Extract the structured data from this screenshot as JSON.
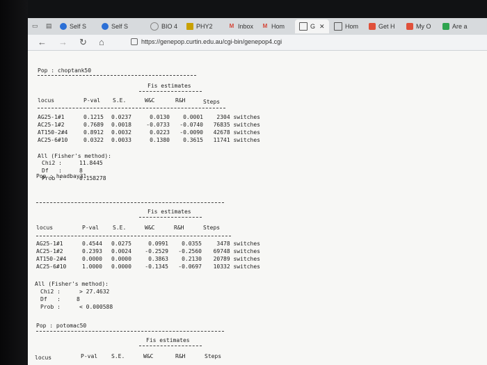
{
  "browser": {
    "tabs": [
      {
        "label": "Self S",
        "color": "#2b6fd6"
      },
      {
        "label": "Self S",
        "color": "#2b6fd6"
      },
      {
        "label": "BIO 4",
        "color": "#888"
      },
      {
        "label": "PHY2",
        "color": "#c8a000"
      },
      {
        "label": "Inbox",
        "color": "#d44638"
      },
      {
        "label": "Hom",
        "color": "#d44638"
      },
      {
        "label": "G",
        "color": "#666"
      },
      {
        "label": "Hom",
        "color": "#666"
      },
      {
        "label": "Get H",
        "color": "#e0503a"
      },
      {
        "label": "My O",
        "color": "#e0503a"
      },
      {
        "label": "Are a",
        "color": "#2ea44f"
      }
    ],
    "close_glyph": "✕",
    "url": "https://genepop.curtin.edu.au/cgi-bin/genepop4.cgi"
  },
  "sections": [
    {
      "pop": "Pop : choptank50",
      "fis_title": "Fis estimates",
      "headers": {
        "locus": "locus",
        "pval": "P-val",
        "se": "S.E.",
        "wc": "W&C",
        "rh": "R&H",
        "steps": "Steps"
      },
      "rows": [
        {
          "locus": "AG25-1#1",
          "pval": "0.1215",
          "se": "0.0237",
          "wc": "0.0130",
          "rh": "0.0001",
          "steps": "2304 switches"
        },
        {
          "locus": "AC25-1#2",
          "pval": "0.7689",
          "se": "0.0018",
          "wc": "-0.0733",
          "rh": "-0.0740",
          "steps": "76835 switches"
        },
        {
          "locus": "AT150-2#4",
          "pval": "0.8912",
          "se": "0.0032",
          "wc": "0.0223",
          "rh": "-0.0090",
          "steps": "42678 switches"
        },
        {
          "locus": "AC25-6#10",
          "pval": "0.0322",
          "se": "0.0033",
          "wc": "0.1380",
          "rh": "0.3615",
          "steps": "11741 switches"
        }
      ],
      "all_label": "All (Fisher's method):",
      "chi2_label": "Chi2 :",
      "chi2": "11.8445",
      "df_label": "Df   :",
      "df": "8",
      "prob_label": "Prob :",
      "prob": "0.158278"
    },
    {
      "pop": "Pop : headbay31",
      "fis_title": "Fis estimates",
      "headers": {
        "locus": "locus",
        "pval": "P-val",
        "se": "S.E.",
        "wc": "W&C",
        "rh": "R&H",
        "steps": "Steps"
      },
      "rows": [
        {
          "locus": "AG25-1#1",
          "pval": "0.4544",
          "se": "0.0275",
          "wc": "0.0991",
          "rh": "0.0355",
          "steps": "3478 switches"
        },
        {
          "locus": "AC25-1#2",
          "pval": "0.2393",
          "se": "0.0024",
          "wc": "-0.2529",
          "rh": "-0.2560",
          "steps": "69748 switches"
        },
        {
          "locus": "AT150-2#4",
          "pval": "0.0000",
          "se": "0.0000",
          "wc": "0.3863",
          "rh": "0.2130",
          "steps": "20789 switches"
        },
        {
          "locus": "AC25-6#10",
          "pval": "1.0000",
          "se": "0.0000",
          "wc": "-0.1345",
          "rh": "-0.0697",
          "steps": "10332 switches"
        }
      ],
      "all_label": "All (Fisher's method):",
      "chi2_label": "Chi2 :",
      "chi2": "> 27.4632",
      "df_label": "Df   :",
      "df": "8",
      "prob_label": "Prob :",
      "prob": "< 0.000588"
    },
    {
      "pop": "Pop : potomac50",
      "fis_title": "Fis estimates",
      "headers": {
        "locus": "locus",
        "pval": "P-val",
        "se": "S.E.",
        "wc": "W&C",
        "rh": "R&H",
        "steps": "Steps"
      }
    }
  ]
}
